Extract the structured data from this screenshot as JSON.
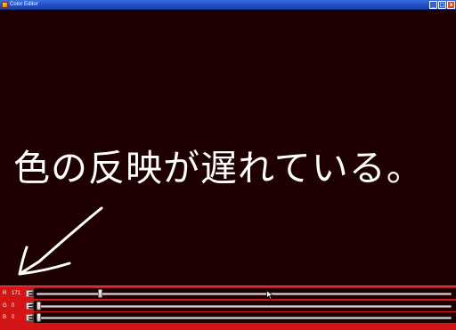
{
  "window": {
    "title": "Color Editor",
    "buttons": {
      "minimize": "_",
      "maximize": "□",
      "close": "x"
    }
  },
  "canvas": {
    "background_color": "#1f0000",
    "caption": "色の反映が遅れている。",
    "arrow": "hand-drawn-arrow-pointing-down-left"
  },
  "controls": {
    "panel_color": "#d41515",
    "channels": [
      {
        "label": "R",
        "value": "171",
        "slider_fraction": 0.15
      },
      {
        "label": "G",
        "value": "0",
        "slider_fraction": 0.0
      },
      {
        "label": "B",
        "value": "0",
        "slider_fraction": 0.0
      }
    ]
  }
}
